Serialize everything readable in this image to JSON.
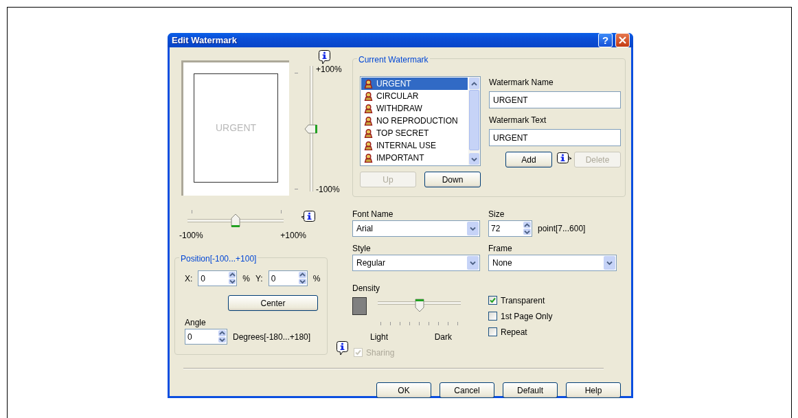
{
  "window": {
    "title": "Edit Watermark",
    "help_button": "?"
  },
  "preview": {
    "text": "URGENT"
  },
  "vertical_slider": {
    "top_label": "+100%",
    "bottom_label": "-100%",
    "level": 0.5
  },
  "horizontal_slider": {
    "left_label": "-100%",
    "right_label": "+100%",
    "level": 0.5
  },
  "position": {
    "title": "Position[-100...+100]",
    "x_label": "X:",
    "x_value": "0",
    "x_unit": "%",
    "y_label": "Y:",
    "y_value": "0",
    "y_unit": "%",
    "center_button": "Center",
    "angle_label": "Angle",
    "angle_value": "0",
    "angle_range": "Degrees[-180...+180]"
  },
  "current_watermark": {
    "title": "Current Watermark",
    "items": [
      {
        "label": "URGENT",
        "selected": true
      },
      {
        "label": "CIRCULAR",
        "selected": false
      },
      {
        "label": "WITHDRAW",
        "selected": false
      },
      {
        "label": "NO REPRODUCTION",
        "selected": false
      },
      {
        "label": "TOP SECRET",
        "selected": false
      },
      {
        "label": "INTERNAL USE",
        "selected": false
      },
      {
        "label": "IMPORTANT",
        "selected": false
      }
    ],
    "buttons": [
      {
        "label": "Up",
        "disabled": true
      },
      {
        "label": "Down",
        "disabled": false
      }
    ],
    "watermark_name": {
      "label": "Watermark Name",
      "value": "URGENT"
    },
    "watermark_text": {
      "label": "Watermark Text",
      "value": "URGENT"
    },
    "add_button": {
      "label": "Add",
      "disabled": false
    },
    "delete_button": {
      "label": "Delete",
      "disabled": true
    }
  },
  "font_name": {
    "label": "Font Name",
    "value": "Arial"
  },
  "size": {
    "label": "Size",
    "value": "72",
    "range": "point[7...600]"
  },
  "style": {
    "label": "Style",
    "value": "Regular"
  },
  "frame": {
    "label": "Frame",
    "value": "None"
  },
  "density": {
    "label": "Density",
    "level": 0.5,
    "light_label": "Light",
    "dark_label": "Dark"
  },
  "options": [
    {
      "label": "Transparent",
      "checked": true
    },
    {
      "label": "1st Page Only",
      "checked": false
    },
    {
      "label": "Repeat",
      "checked": false
    }
  ],
  "sharing": {
    "label": "Sharing",
    "checked": true,
    "disabled": true
  },
  "buttons": [
    {
      "label": "OK"
    },
    {
      "label": "Cancel"
    },
    {
      "label": "Default"
    },
    {
      "label": "Help"
    }
  ]
}
